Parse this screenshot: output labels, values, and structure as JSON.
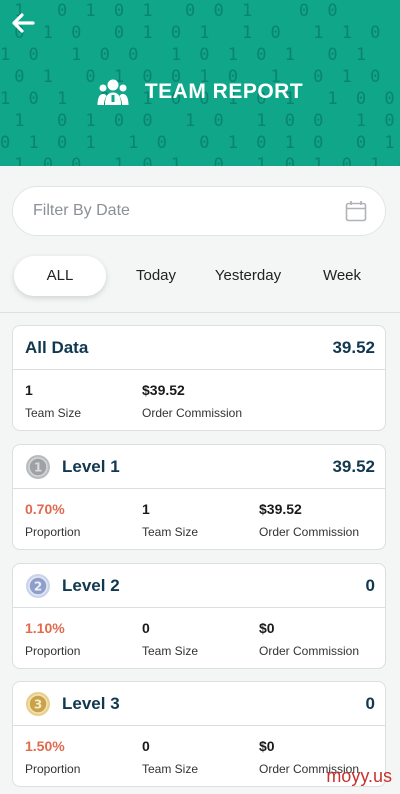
{
  "header": {
    "title": "TEAM REPORT",
    "color": "#0fa68a"
  },
  "filter": {
    "placeholder": "Filter By Date"
  },
  "tabs": [
    {
      "label": "ALL",
      "active": true
    },
    {
      "label": "Today",
      "active": false
    },
    {
      "label": "Yesterday",
      "active": false
    },
    {
      "label": "Week",
      "active": false
    }
  ],
  "all_data": {
    "title": "All Data",
    "value": "39.52",
    "team_size_value": "1",
    "team_size_label": "Team Size",
    "commission_value": "$39.52",
    "commission_label": "Order Commission"
  },
  "levels": [
    {
      "title": "Level 1",
      "value": "39.52",
      "medal": "1",
      "proportion_value": "0.70%",
      "proportion_label": "Proportion",
      "team_size_value": "1",
      "team_size_label": "Team Size",
      "commission_value": "$39.52",
      "commission_label": "Order Commission"
    },
    {
      "title": "Level 2",
      "value": "0",
      "medal": "2",
      "proportion_value": "1.10%",
      "proportion_label": "Proportion",
      "team_size_value": "0",
      "team_size_label": "Team Size",
      "commission_value": "$0",
      "commission_label": "Order Commission"
    },
    {
      "title": "Level 3",
      "value": "0",
      "medal": "3",
      "proportion_value": "1.50%",
      "proportion_label": "Proportion",
      "team_size_value": "0",
      "team_size_label": "Team Size",
      "commission_value": "$0",
      "commission_label": "Order Commission"
    }
  ],
  "watermark": "moyy.us"
}
